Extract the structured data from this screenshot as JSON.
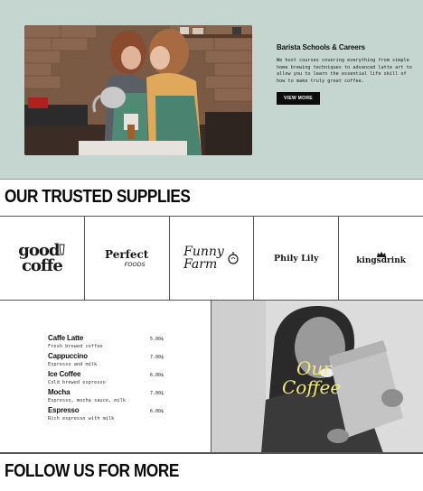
{
  "hero": {
    "title": "Barista Schools & Careers",
    "description": "We host courses covering everything from simple home brewing techniques to advanced latte art to allow you to learn the essential life skill of how to make truly great coffee.",
    "button_label": "VIEW MORE"
  },
  "supplies": {
    "title": "OUR TRUSTED SUPPLIES",
    "logos": [
      {
        "line1": "good",
        "line2": "coffe"
      },
      {
        "line1": "Perfect",
        "line2": "FOODS"
      },
      {
        "line1": "Funny",
        "line2": "Farm"
      },
      {
        "line1": "Phily Lily"
      },
      {
        "line1": "kingsdrink"
      }
    ]
  },
  "menu": {
    "items": [
      {
        "name": "Caffe Latte",
        "price": "5.00$",
        "desc": "Fresh brewed coffee"
      },
      {
        "name": "Cappuccino",
        "price": "7.00$",
        "desc": "Espresso and milk"
      },
      {
        "name": "Ice Coffee",
        "price": "6.00$",
        "desc": "Cold brewed espresso"
      },
      {
        "name": "Mocha",
        "price": "7.00$",
        "desc": "Espresso, mocha sauce, milk"
      },
      {
        "name": "Espresso",
        "price": "6.00$",
        "desc": "Rich espresso with milk"
      }
    ]
  },
  "promo": {
    "line1": "Our",
    "line2": "Coffee"
  },
  "follow": {
    "title": "FOLLOW US FOR MORE"
  },
  "colors": {
    "hero_bg": "#c5d6d0",
    "button_bg": "#0c0c0c",
    "promo_text": "#f3e87a"
  }
}
